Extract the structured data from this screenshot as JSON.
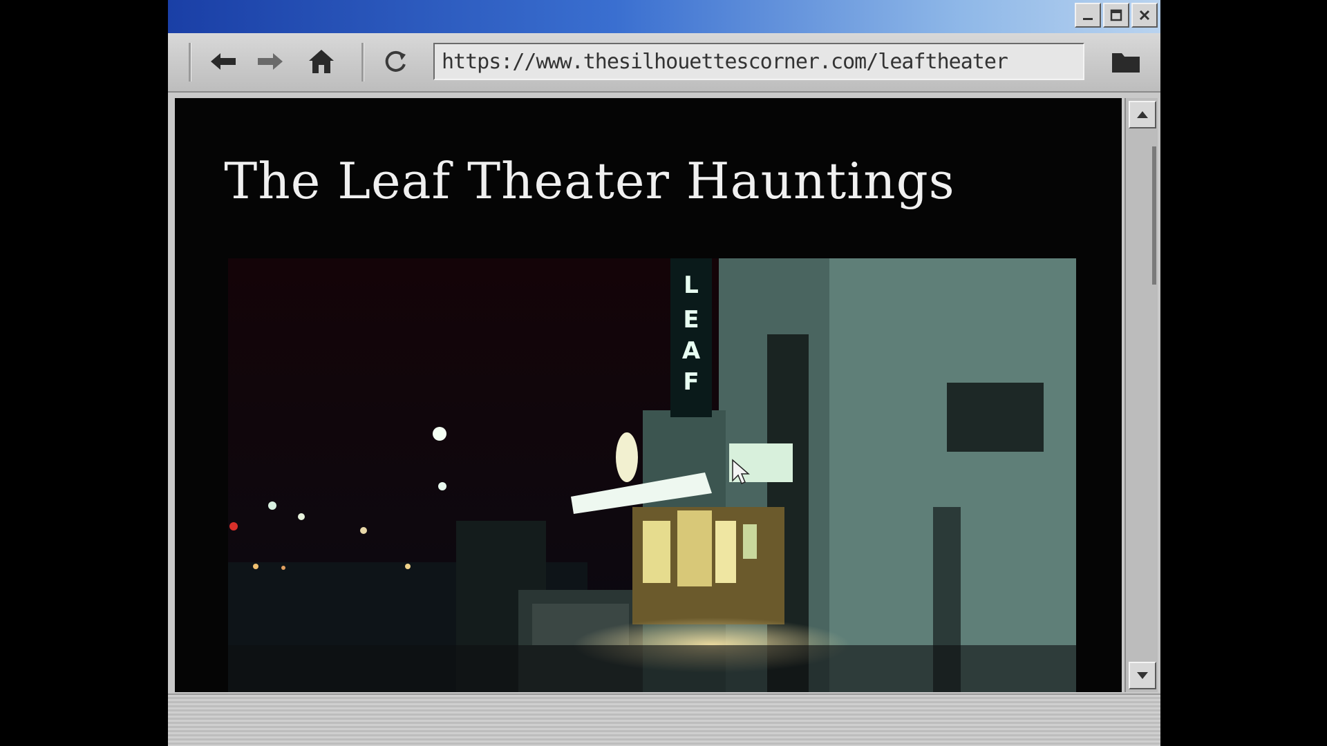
{
  "browser": {
    "url": "https://www.thesilhouettescorner.com/leaftheater",
    "window_buttons": [
      "minimize",
      "maximize",
      "close"
    ],
    "nav_icons": [
      "back-arrow-icon",
      "forward-arrow-icon",
      "home-icon",
      "refresh-icon",
      "folder-icon"
    ]
  },
  "page": {
    "title": "The Leaf Theater Hauntings",
    "sign_letters": [
      "L",
      "E",
      "A",
      "F"
    ]
  },
  "colors": {
    "titlebar_left": "#1a3fa6",
    "titlebar_right": "#b9d3ef",
    "page_bg": "#050505",
    "neon": "#eaf6ee",
    "building": "#5f7f78"
  }
}
